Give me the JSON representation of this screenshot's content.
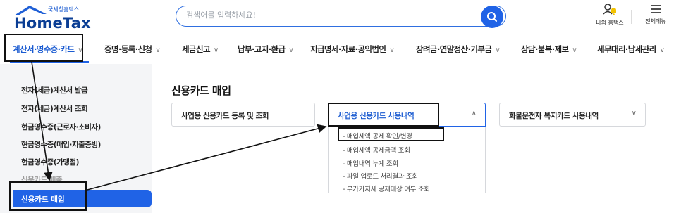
{
  "header": {
    "logo_sub": "국세청홈택스",
    "logo_main": "HomeTax",
    "search_placeholder": "검색어를 입력하세요!",
    "my_home_label": "나의 홈택스",
    "all_menu_label": "전체메뉴",
    "icons": {
      "search": "search-icon",
      "my_home": "user-bell-icon",
      "all_menu": "hamburger-icon"
    }
  },
  "gnb": {
    "items": [
      {
        "label": "계산서·영수증·카드",
        "active": true
      },
      {
        "label": "증명·등록·신청"
      },
      {
        "label": "세금신고"
      },
      {
        "label": "납부·고지·환급"
      },
      {
        "label": "지급명세·자료·공익법인"
      },
      {
        "label": "장려금·연말정산·기부금"
      },
      {
        "label": "상담·불복·제보"
      },
      {
        "label": "세무대리·납세관리"
      }
    ],
    "chevron": "∨"
  },
  "sidebar": {
    "items": [
      {
        "label": "전자(세금)계산서 발급"
      },
      {
        "label": "전자(세금)계산서 조회"
      },
      {
        "label": "현금영수증(근로자·소비자)"
      },
      {
        "label": "현금영수증(매입·지출증빙)"
      },
      {
        "label": "현금영수증(가맹점)"
      },
      {
        "label": "신용카드 매출"
      },
      {
        "label": "신용카드 매입"
      }
    ],
    "active_index": 6
  },
  "main": {
    "title": "신용카드 매입",
    "cards": [
      {
        "label": "사업용 신용카드 등록 및 조회",
        "chevron": ""
      },
      {
        "label": "사업용 신용카드 사용내역",
        "chevron": "∧",
        "open": true
      },
      {
        "label": "화물운전자 복지카드 사용내역",
        "chevron": "∨"
      }
    ],
    "submenu": [
      {
        "label": "- 매입세액 공제 확인/변경"
      },
      {
        "label": "- 매입세액 공제금액 조회"
      },
      {
        "label": "- 매입내역 누계 조회"
      },
      {
        "label": "- 파일 업로드 처리결과 조회"
      },
      {
        "label": "- 부가가치세 공제대상 여부 조회"
      }
    ]
  },
  "colors": {
    "brand_blue": "#2063e6",
    "dark_navy": "#0b3e94",
    "sidebar_bg": "#f4f5f7"
  }
}
